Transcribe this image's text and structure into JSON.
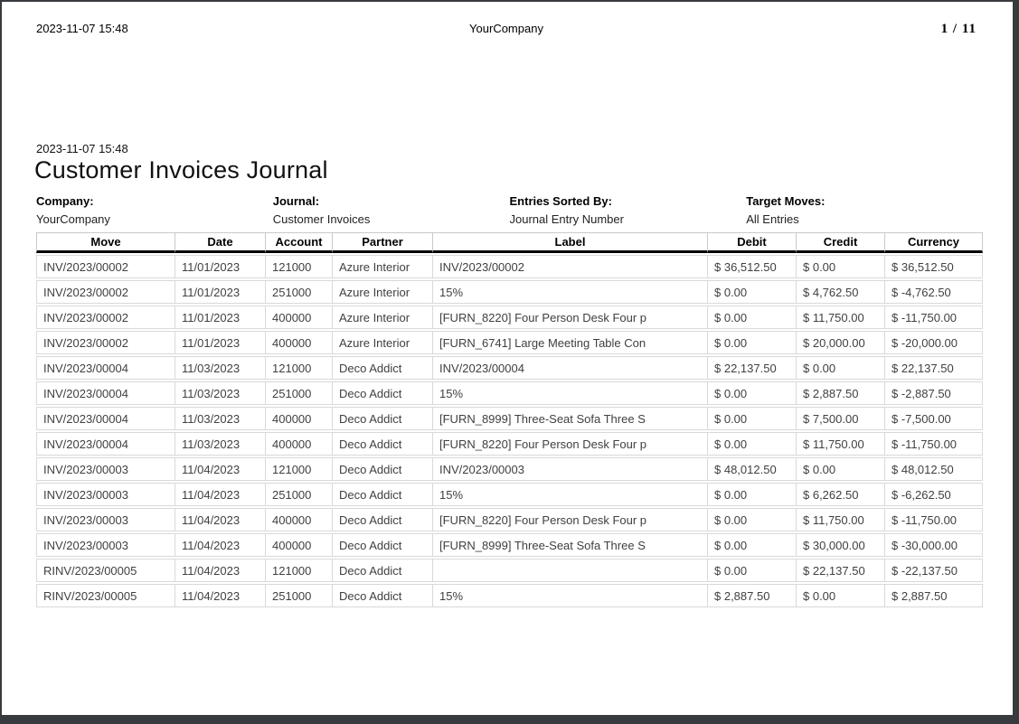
{
  "header": {
    "datetime": "2023-11-07 15:48",
    "company": "YourCompany",
    "pages": "1 / 11"
  },
  "report": {
    "datetime": "2023-11-07 15:48",
    "title": "Customer Invoices Journal",
    "meta": [
      {
        "label": "Company:",
        "value": "YourCompany"
      },
      {
        "label": "Journal:",
        "value": "Customer Invoices"
      },
      {
        "label": "Entries Sorted By:",
        "value": "Journal Entry Number"
      },
      {
        "label": "Target Moves:",
        "value": "All Entries"
      }
    ]
  },
  "table": {
    "columns": [
      "Move",
      "Date",
      "Account",
      "Partner",
      "Label",
      "Debit",
      "Credit",
      "Currency"
    ],
    "rows": [
      [
        "INV/2023/00002",
        "11/01/2023",
        "121000",
        "Azure Interior",
        "INV/2023/00002",
        "$ 36,512.50",
        "$ 0.00",
        "$ 36,512.50"
      ],
      [
        "INV/2023/00002",
        "11/01/2023",
        "251000",
        "Azure Interior",
        "15%",
        "$ 0.00",
        "$ 4,762.50",
        "$ -4,762.50"
      ],
      [
        "INV/2023/00002",
        "11/01/2023",
        "400000",
        "Azure Interior",
        "[FURN_8220] Four Person Desk Four p",
        "$ 0.00",
        "$ 11,750.00",
        "$ -11,750.00"
      ],
      [
        "INV/2023/00002",
        "11/01/2023",
        "400000",
        "Azure Interior",
        "[FURN_6741] Large Meeting Table Con",
        "$ 0.00",
        "$ 20,000.00",
        "$ -20,000.00"
      ],
      [
        "INV/2023/00004",
        "11/03/2023",
        "121000",
        "Deco Addict",
        "INV/2023/00004",
        "$ 22,137.50",
        "$ 0.00",
        "$ 22,137.50"
      ],
      [
        "INV/2023/00004",
        "11/03/2023",
        "251000",
        "Deco Addict",
        "15%",
        "$ 0.00",
        "$ 2,887.50",
        "$ -2,887.50"
      ],
      [
        "INV/2023/00004",
        "11/03/2023",
        "400000",
        "Deco Addict",
        "[FURN_8999] Three-Seat Sofa Three S",
        "$ 0.00",
        "$ 7,500.00",
        "$ -7,500.00"
      ],
      [
        "INV/2023/00004",
        "11/03/2023",
        "400000",
        "Deco Addict",
        "[FURN_8220] Four Person Desk Four p",
        "$ 0.00",
        "$ 11,750.00",
        "$ -11,750.00"
      ],
      [
        "INV/2023/00003",
        "11/04/2023",
        "121000",
        "Deco Addict",
        "INV/2023/00003",
        "$ 48,012.50",
        "$ 0.00",
        "$ 48,012.50"
      ],
      [
        "INV/2023/00003",
        "11/04/2023",
        "251000",
        "Deco Addict",
        "15%",
        "$ 0.00",
        "$ 6,262.50",
        "$ -6,262.50"
      ],
      [
        "INV/2023/00003",
        "11/04/2023",
        "400000",
        "Deco Addict",
        "[FURN_8220] Four Person Desk Four p",
        "$ 0.00",
        "$ 11,750.00",
        "$ -11,750.00"
      ],
      [
        "INV/2023/00003",
        "11/04/2023",
        "400000",
        "Deco Addict",
        "[FURN_8999] Three-Seat Sofa Three S",
        "$ 0.00",
        "$ 30,000.00",
        "$ -30,000.00"
      ],
      [
        "RINV/2023/00005",
        "11/04/2023",
        "121000",
        "Deco Addict",
        "",
        "$ 0.00",
        "$ 22,137.50",
        "$ -22,137.50"
      ],
      [
        "RINV/2023/00005",
        "11/04/2023",
        "251000",
        "Deco Addict",
        "15%",
        "$ 2,887.50",
        "$ 0.00",
        "$ 2,887.50"
      ]
    ]
  },
  "colors": {
    "page_bg": "#ffffff",
    "viewer_bg": "#383b3e",
    "table_border": "#d9d9d9",
    "header_rule": "#000000",
    "body_text": "#404040"
  }
}
